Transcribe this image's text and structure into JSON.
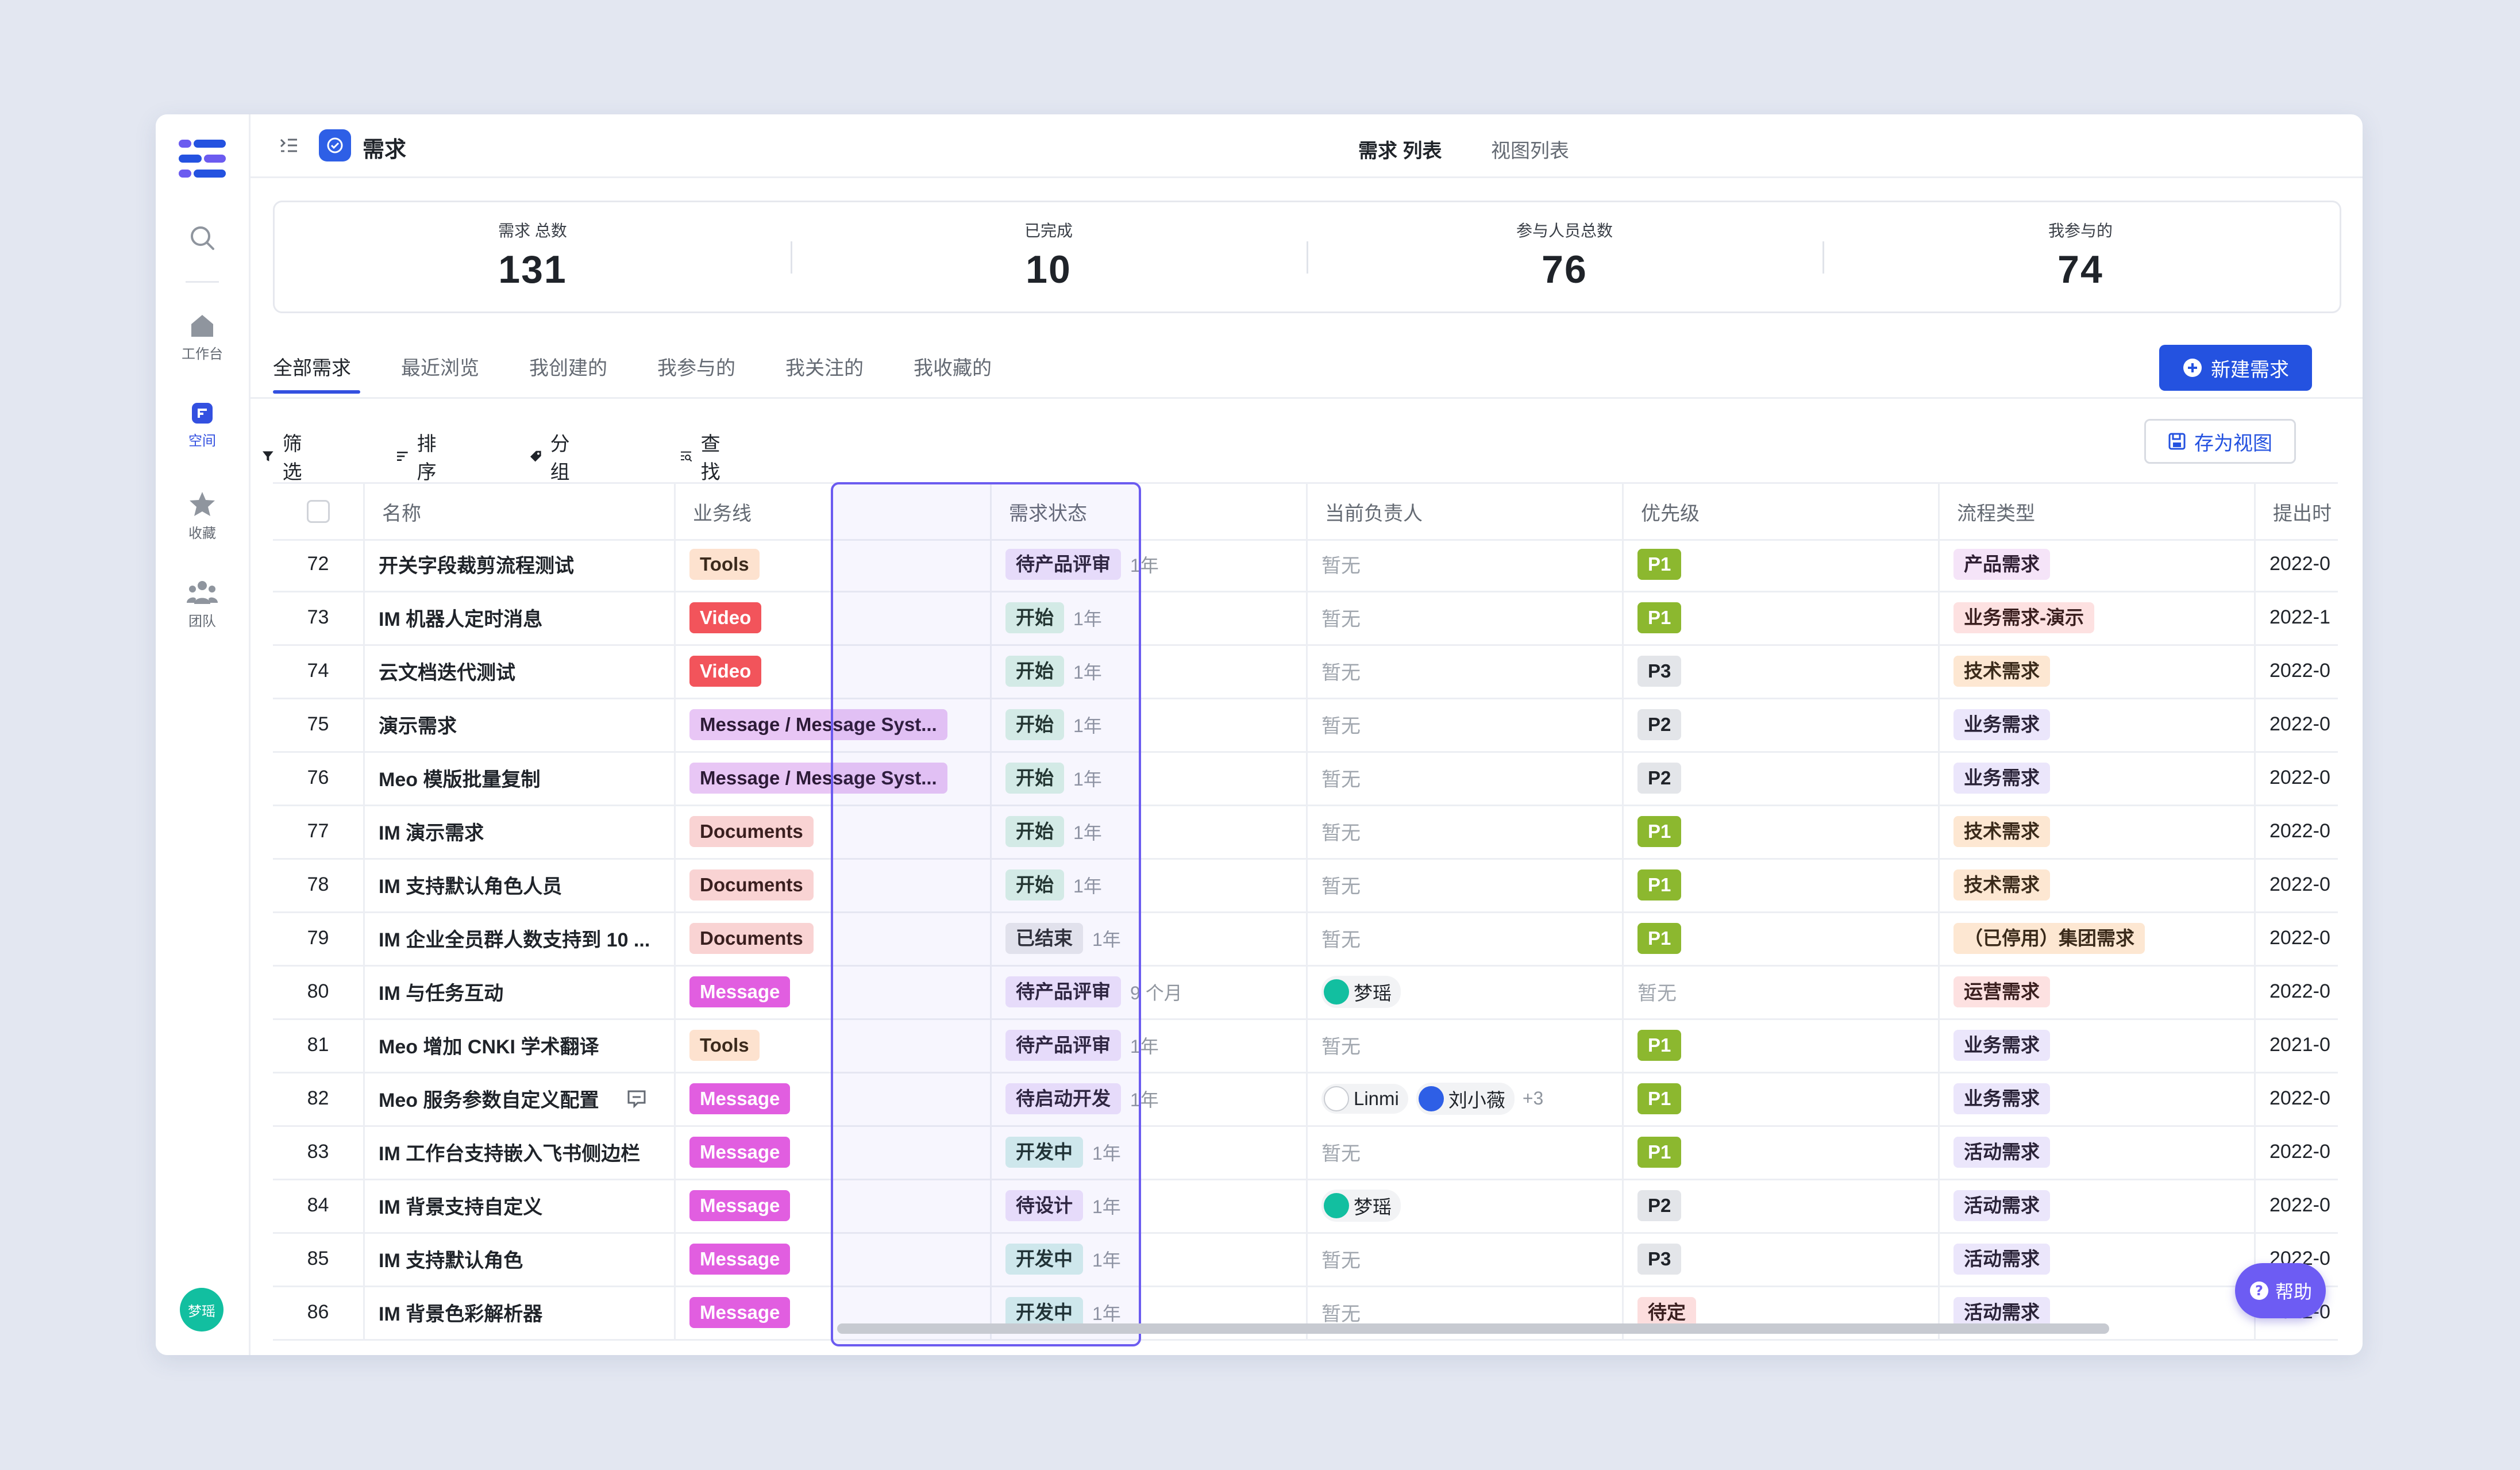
{
  "sidebar": {
    "items": [
      {
        "label": ""
      },
      {
        "label": "工作台"
      },
      {
        "label": "空间"
      },
      {
        "label": "收藏"
      },
      {
        "label": "团队"
      }
    ],
    "user_avatar": "梦瑶"
  },
  "header": {
    "app_title": "需求",
    "tabs": [
      "需求 列表",
      "视图列表"
    ]
  },
  "stats": [
    {
      "label": "需求 总数",
      "value": "131"
    },
    {
      "label": "已完成",
      "value": "10"
    },
    {
      "label": "参与人员总数",
      "value": "76"
    },
    {
      "label": "我参与的",
      "value": "74"
    }
  ],
  "view_tabs": [
    "全部需求",
    "最近浏览",
    "我创建的",
    "我参与的",
    "我关注的",
    "我收藏的"
  ],
  "new_button": "新建需求",
  "toolbar": {
    "filter": "筛选",
    "sort": "排序",
    "group": "分组",
    "find": "查找",
    "save_view": "存为视图"
  },
  "table": {
    "columns": [
      "名称",
      "业务线",
      "需求状态",
      "当前负责人",
      "优先级",
      "流程类型",
      "提出时"
    ],
    "empty_text": "暂无",
    "rows": [
      {
        "id": "72",
        "name": "开关字段裁剪流程测试",
        "line": "Tools",
        "status": "待产品评审",
        "age": "1年",
        "owner": [],
        "priority": "P1",
        "flow": "产品需求",
        "date": "2022-0"
      },
      {
        "id": "73",
        "name": "IM 机器人定时消息",
        "line": "Video",
        "status": "开始",
        "age": "1年",
        "owner": [],
        "priority": "P1",
        "flow": "业务需求-演示",
        "date": "2022-1"
      },
      {
        "id": "74",
        "name": "云文档迭代测试",
        "line": "Video",
        "status": "开始",
        "age": "1年",
        "owner": [],
        "priority": "P3",
        "flow": "技术需求",
        "date": "2022-0"
      },
      {
        "id": "75",
        "name": "演示需求",
        "line": "Message / Message Syst...",
        "status": "开始",
        "age": "1年",
        "owner": [],
        "priority": "P2",
        "flow": "业务需求",
        "date": "2022-0"
      },
      {
        "id": "76",
        "name": "Meo 模版批量复制",
        "line": "Message / Message Syst...",
        "status": "开始",
        "age": "1年",
        "owner": [],
        "priority": "P2",
        "flow": "业务需求",
        "date": "2022-0"
      },
      {
        "id": "77",
        "name": "IM 演示需求",
        "line": "Documents",
        "status": "开始",
        "age": "1年",
        "owner": [],
        "priority": "P1",
        "flow": "技术需求",
        "date": "2022-0"
      },
      {
        "id": "78",
        "name": "IM 支持默认角色人员",
        "line": "Documents",
        "status": "开始",
        "age": "1年",
        "owner": [],
        "priority": "P1",
        "flow": "技术需求",
        "date": "2022-0"
      },
      {
        "id": "79",
        "name": "IM 企业全员群人数支持到 10 ...",
        "line": "Documents",
        "status": "已结束",
        "age": "1年",
        "owner": [],
        "priority": "P1",
        "flow": "（已停用）集团需求",
        "date": "2022-0"
      },
      {
        "id": "80",
        "name": "IM 与任务互动",
        "line": "Message",
        "status": "待产品评审",
        "age": "9 个月",
        "owner": [
          "梦瑶"
        ],
        "priority": "",
        "flow": "运营需求",
        "date": "2022-0"
      },
      {
        "id": "81",
        "name": "Meo 增加 CNKI 学术翻译",
        "line": "Tools",
        "status": "待产品评审",
        "age": "1年",
        "owner": [],
        "priority": "P1",
        "flow": "业务需求",
        "date": "2021-0"
      },
      {
        "id": "82",
        "name": "Meo 服务参数自定义配置",
        "line": "Message",
        "status": "待启动开发",
        "age": "1年",
        "owner": [
          "Linmi",
          "刘小薇"
        ],
        "owner_more": "+3",
        "priority": "P1",
        "flow": "业务需求",
        "date": "2022-0"
      },
      {
        "id": "83",
        "name": "IM 工作台支持嵌入飞书侧边栏",
        "line": "Message",
        "status": "开发中",
        "age": "1年",
        "owner": [],
        "priority": "P1",
        "flow": "活动需求",
        "date": "2022-0"
      },
      {
        "id": "84",
        "name": "IM 背景支持自定义",
        "line": "Message",
        "status": "待设计",
        "age": "1年",
        "owner": [
          "梦瑶"
        ],
        "priority": "P2",
        "flow": "活动需求",
        "date": "2022-0"
      },
      {
        "id": "85",
        "name": "IM 支持默认角色",
        "line": "Message",
        "status": "开发中",
        "age": "1年",
        "owner": [],
        "priority": "P3",
        "flow": "活动需求",
        "date": "2022-0"
      },
      {
        "id": "86",
        "name": "IM 背景色彩解析器",
        "line": "Message",
        "status": "开发中",
        "age": "1年",
        "owner": [],
        "priority": "待定",
        "flow": "活动需求",
        "date": "2022-0"
      }
    ]
  },
  "help_button": "帮助",
  "colors": {
    "accent": "#2452e0",
    "highlight": "#6b5bf0",
    "line_tags": {
      "Tools": {
        "bg": "#fde2cf",
        "fg": "#3b2a1c"
      },
      "Video": {
        "bg": "#f2545b",
        "fg": "#ffffff"
      },
      "Message / Message Syst...": {
        "bg": "#e8c6f5",
        "fg": "#2c1a36"
      },
      "Documents": {
        "bg": "#f9d3d3",
        "fg": "#3a1f1f"
      },
      "Message": {
        "bg": "#e15ee0",
        "fg": "#ffffff"
      }
    },
    "status_tags": {
      "待产品评审": {
        "bg": "#ede3fb",
        "fg": "#2b2338"
      },
      "开始": {
        "bg": "#d9f3e6",
        "fg": "#1f3328"
      },
      "已结束": {
        "bg": "#e8e9ec",
        "fg": "#2b2d31"
      },
      "待启动开发": {
        "bg": "#ede3fb",
        "fg": "#2b2338"
      },
      "开发中": {
        "bg": "#d4f0ec",
        "fg": "#1c302c"
      },
      "待设计": {
        "bg": "#ede3fb",
        "fg": "#2b2338"
      }
    },
    "priority_tags": {
      "P1": {
        "bg": "#8cb82f",
        "fg": "#ffffff"
      },
      "P2": {
        "bg": "#e3e5e9",
        "fg": "#1f2329"
      },
      "P3": {
        "bg": "#e3e5e9",
        "fg": "#1f2329"
      },
      "待定": {
        "bg": "#fcdede",
        "fg": "#3a1f1f"
      }
    },
    "flow_tags": {
      "产品需求": {
        "bg": "#f5e4f8",
        "fg": "#2f1f33"
      },
      "业务需求-演示": {
        "bg": "#fde1e1",
        "fg": "#3a1f1f"
      },
      "技术需求": {
        "bg": "#fde7d2",
        "fg": "#3a2a1a"
      },
      "业务需求": {
        "bg": "#ebe6fb",
        "fg": "#2a2338"
      },
      "（已停用）集团需求": {
        "bg": "#fde7d2",
        "fg": "#3a2a1a"
      },
      "运营需求": {
        "bg": "#fde1e1",
        "fg": "#3a1f1f"
      },
      "活动需求": {
        "bg": "#ebe6fb",
        "fg": "#2a2338"
      }
    }
  }
}
